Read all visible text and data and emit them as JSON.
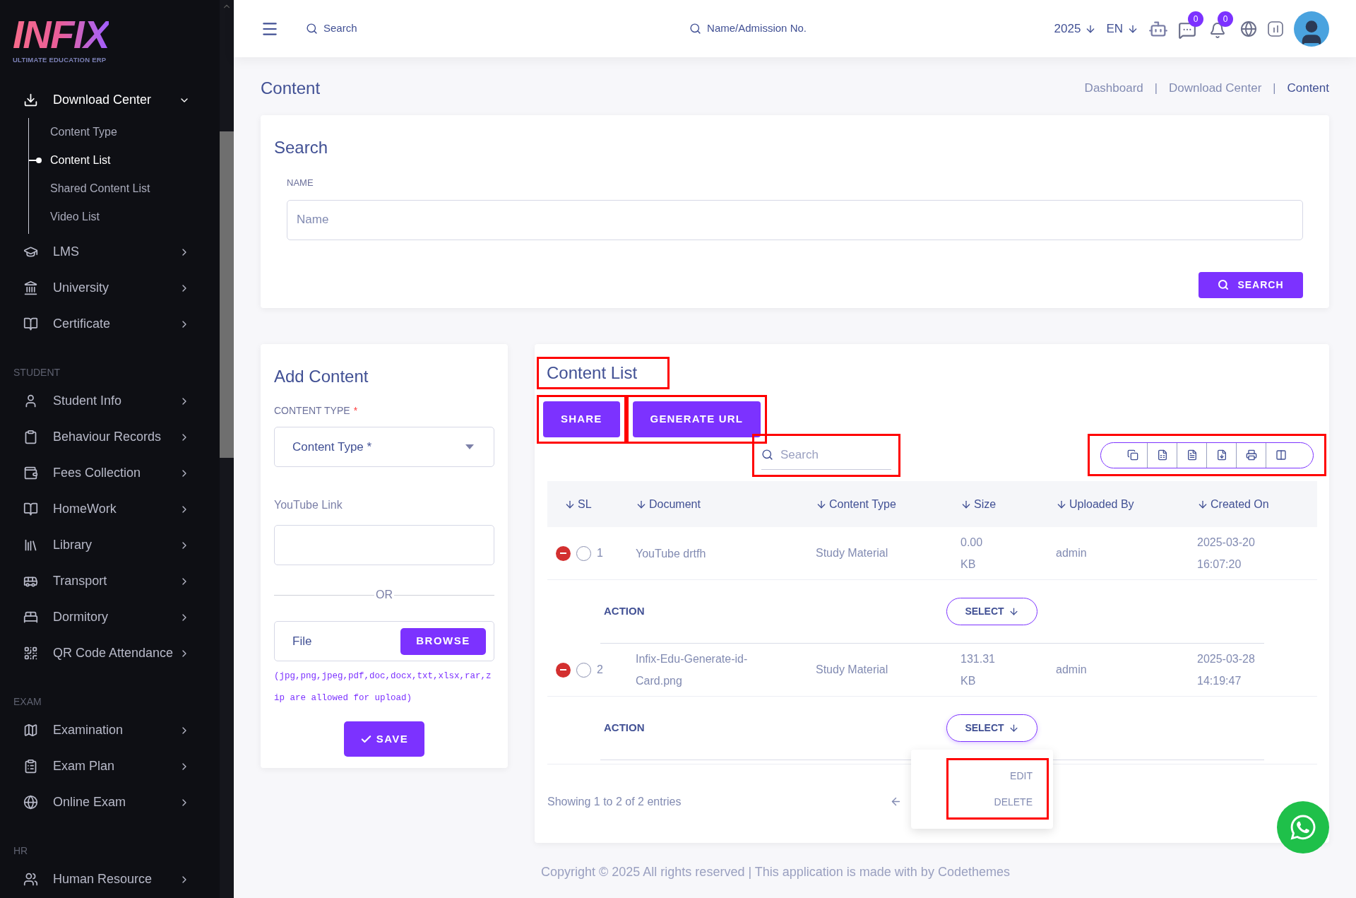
{
  "sidebar": {
    "logo": {
      "name": "INFIX",
      "tagline": "ULTIMATE EDUCATION ERP"
    },
    "sections": [
      {
        "items": [
          {
            "label": "Download Center",
            "expanded": true,
            "children": [
              {
                "label": "Content Type",
                "selected": false
              },
              {
                "label": "Content List",
                "selected": true
              },
              {
                "label": "Shared Content List",
                "selected": false
              },
              {
                "label": "Video List",
                "selected": false
              }
            ]
          },
          {
            "label": "LMS",
            "expanded": false
          },
          {
            "label": "University",
            "expanded": false
          },
          {
            "label": "Certificate",
            "expanded": false
          }
        ]
      },
      {
        "heading": "STUDENT",
        "items": [
          {
            "label": "Student Info",
            "expanded": false
          },
          {
            "label": "Behaviour Records",
            "expanded": false
          },
          {
            "label": "Fees Collection",
            "expanded": false
          },
          {
            "label": "HomeWork",
            "expanded": false
          },
          {
            "label": "Library",
            "expanded": false
          },
          {
            "label": "Transport",
            "expanded": false
          },
          {
            "label": "Dormitory",
            "expanded": false
          },
          {
            "label": "QR Code Attendance",
            "expanded": false
          }
        ]
      },
      {
        "heading": "EXAM",
        "items": [
          {
            "label": "Examination",
            "expanded": false
          },
          {
            "label": "Exam Plan",
            "expanded": false
          },
          {
            "label": "Online Exam",
            "expanded": false
          }
        ]
      },
      {
        "heading": "HR",
        "items": [
          {
            "label": "Human Resource",
            "expanded": false
          }
        ]
      }
    ]
  },
  "header": {
    "search": {
      "placeholder": "Search"
    },
    "student_search": {
      "placeholder": "Name/Admission No."
    },
    "year": "2025",
    "language": "EN",
    "messages_badge": "0",
    "notifications_badge": "0"
  },
  "page": {
    "title": "Content",
    "breadcrumb_separator": "|",
    "breadcrumbs": [
      {
        "label": "Dashboard",
        "selected": false
      },
      {
        "label": "Download Center",
        "selected": false
      },
      {
        "label": "Content",
        "selected": true
      }
    ]
  },
  "search_card": {
    "title": "Search",
    "field_label": "NAME",
    "placeholder": "Name",
    "button": "SEARCH"
  },
  "add_content": {
    "title": "Add Content",
    "content_type_label": "CONTENT TYPE",
    "required_mark": "*",
    "content_type_placeholder": "Content Type *",
    "youtube_label": "YouTube Link",
    "divider": "OR",
    "file_placeholder": "File",
    "browse": "BROWSE",
    "hint": "(jpg,png,jpeg,pdf,doc,docx,txt,xlsx,rar,zip are allowed for upload)",
    "save": "SAVE"
  },
  "content_list": {
    "title": {
      "text": "Content List",
      "highlighted": true
    },
    "buttons": [
      {
        "label": "SHARE",
        "highlighted": true
      },
      {
        "label": "GENERATE URL",
        "highlighted": true
      }
    ],
    "search": {
      "placeholder": "Search",
      "highlighted": true
    },
    "export_toolbar": {
      "highlighted": true
    },
    "columns": [
      "SL",
      "Document",
      "Content Type",
      "Size",
      "Uploaded By",
      "Created On"
    ],
    "rows": [
      {
        "sl": "1",
        "document": "YouTube drtfh",
        "content_type": "Study Material",
        "size": "0.00 KB",
        "uploaded_by": "admin",
        "created_on": "2025-03-20 16:07:20",
        "selected": false,
        "action_label": "ACTION",
        "select": "SELECT",
        "menu_open": false
      },
      {
        "sl": "2",
        "document": "Infix-Edu-Generate-id-Card.png",
        "content_type": "Study Material",
        "size": "131.31 KB",
        "uploaded_by": "admin",
        "created_on": "2025-03-28 14:19:47",
        "selected": false,
        "action_label": "ACTION",
        "select": "SELECT",
        "menu_open": true
      }
    ],
    "row_menu": {
      "highlighted": true,
      "items": [
        "EDIT",
        "DELETE"
      ]
    },
    "entries_info": "Showing 1 to 2 of 2 entries"
  },
  "footer": "Copyright © 2025 All rights reserved | This application is made with by Codethemes"
}
